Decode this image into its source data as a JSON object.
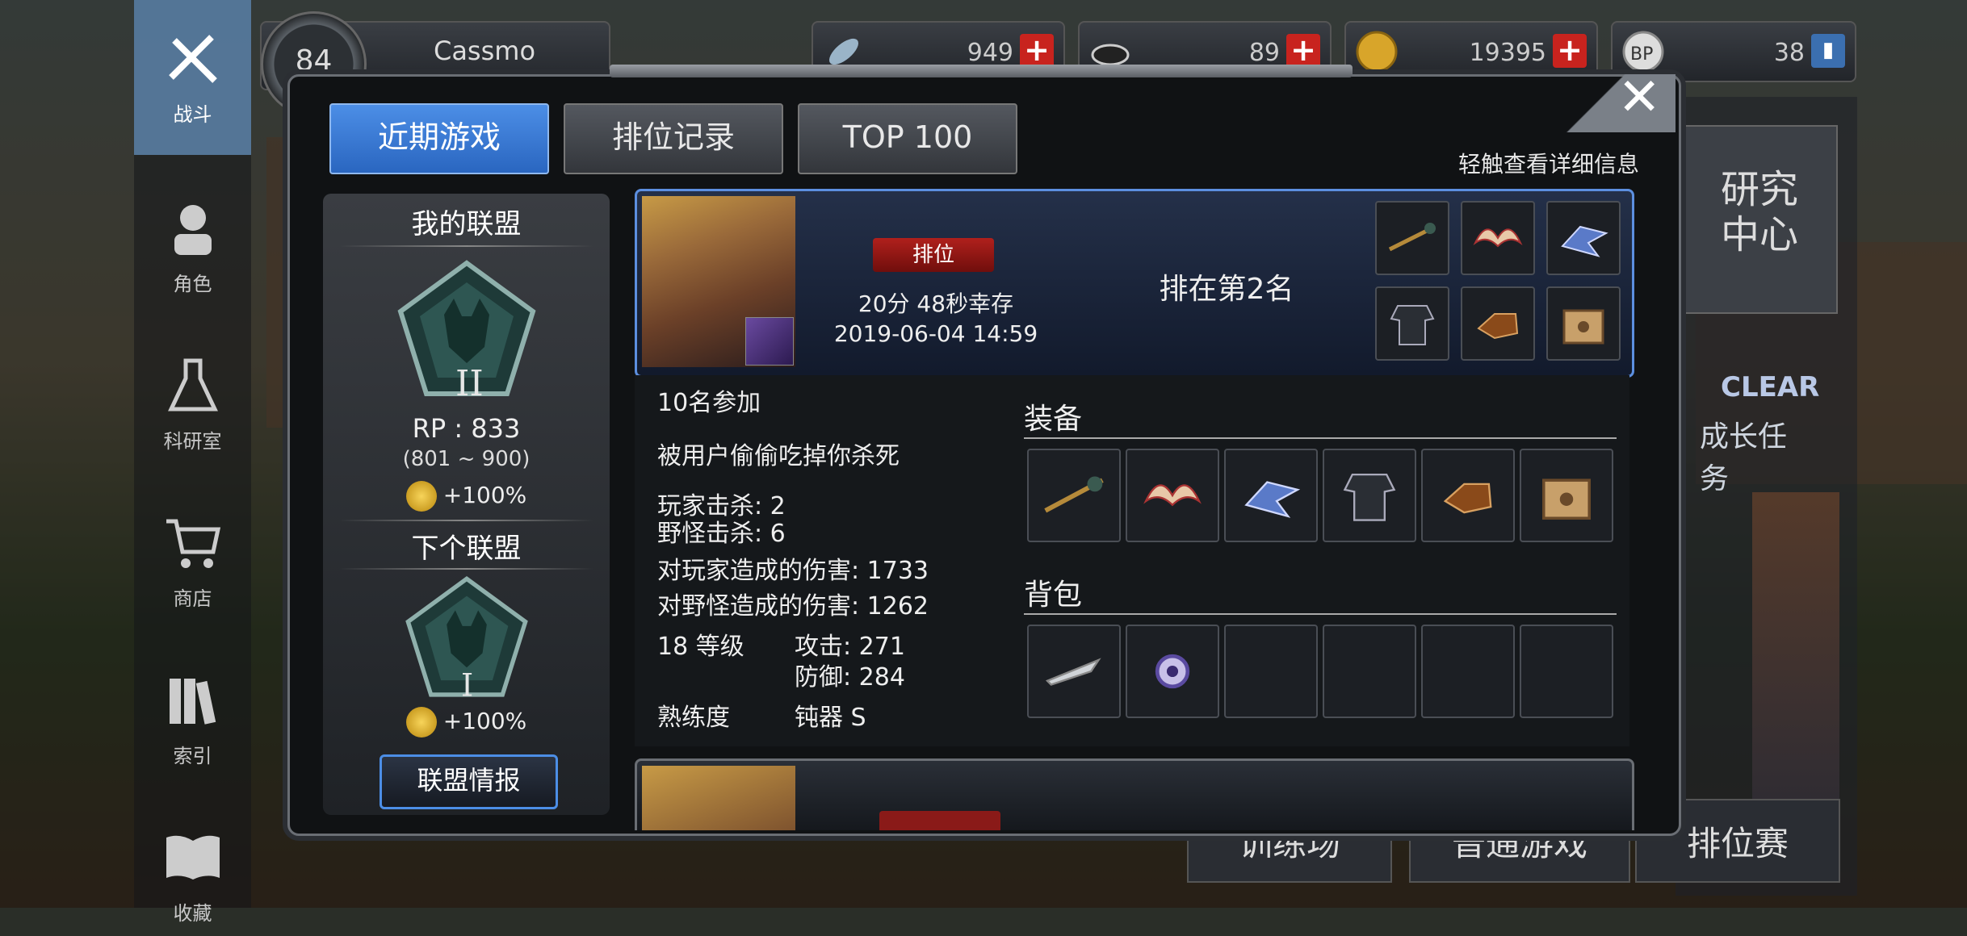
{
  "nav": {
    "items": [
      {
        "label": "战斗",
        "icon": "crossed-guns-icon",
        "active": true
      },
      {
        "label": "角色",
        "icon": "character-icon"
      },
      {
        "label": "科研室",
        "icon": "flask-icon"
      },
      {
        "label": "商店",
        "icon": "cart-icon"
      },
      {
        "label": "索引",
        "icon": "books-icon"
      },
      {
        "label": "收藏",
        "icon": "open-book-icon"
      }
    ]
  },
  "player": {
    "level": "84",
    "name": "Cassmo"
  },
  "resources": [
    {
      "value": "949",
      "icon": "feather-icon"
    },
    {
      "value": "89",
      "icon": "cap-icon"
    },
    {
      "value": "19395",
      "icon": "gold-coin-icon"
    },
    {
      "value": "38",
      "icon": "bp-icon"
    }
  ],
  "right": {
    "research": "研究\n中心",
    "clear_label": "CLEAR",
    "growth_label": "成长任务",
    "bottom_buttons": [
      "训练场",
      "普通游戏",
      "排位赛"
    ]
  },
  "modal": {
    "tabs": [
      "近期游戏",
      "排位记录",
      "TOP 100"
    ],
    "hint": "轻触查看详细信息",
    "close": "✕"
  },
  "league": {
    "my_title": "我的联盟",
    "my_tier": "II",
    "rp": "RP : 833",
    "range": "(801 ~ 900)",
    "bonus": "+100%",
    "next_title": "下个联盟",
    "next_tier": "I",
    "next_bonus": "+100%",
    "info_button": "联盟情报"
  },
  "match": {
    "mode": "排位",
    "survived": "20分 48秒幸存",
    "date": "2019-06-04 14:59",
    "placement": "排在第2名",
    "summary_items": [
      "staff-icon",
      "wings-icon",
      "dragon-icon",
      "armor-icon",
      "gauntlet-icon",
      "box-icon"
    ],
    "participants": "10名参加",
    "killed_by": "被用户偷偷吃掉你杀死",
    "player_kills": "玩家击杀: 2",
    "monster_kills": "野怪击杀: 6",
    "player_damage": "对玩家造成的伤害: 1733",
    "monster_damage": "对野怪造成的伤害: 1262",
    "level": "18 等级",
    "attack": "攻击: 271",
    "defense": "防御: 284",
    "mastery_label": "熟练度",
    "mastery_value": "钝器 S",
    "equip_title": "装备",
    "bag_title": "背包",
    "equipment": [
      "staff-icon",
      "wings-icon",
      "dragon-icon",
      "armor-icon",
      "gauntlet-icon",
      "box-icon"
    ],
    "bag": [
      "feather-blade-icon",
      "orb-icon",
      "",
      "",
      "",
      ""
    ]
  },
  "colors": {
    "accent": "#3b7fdc",
    "rank_red": "#b0201c",
    "plus_red": "#c8231e"
  }
}
